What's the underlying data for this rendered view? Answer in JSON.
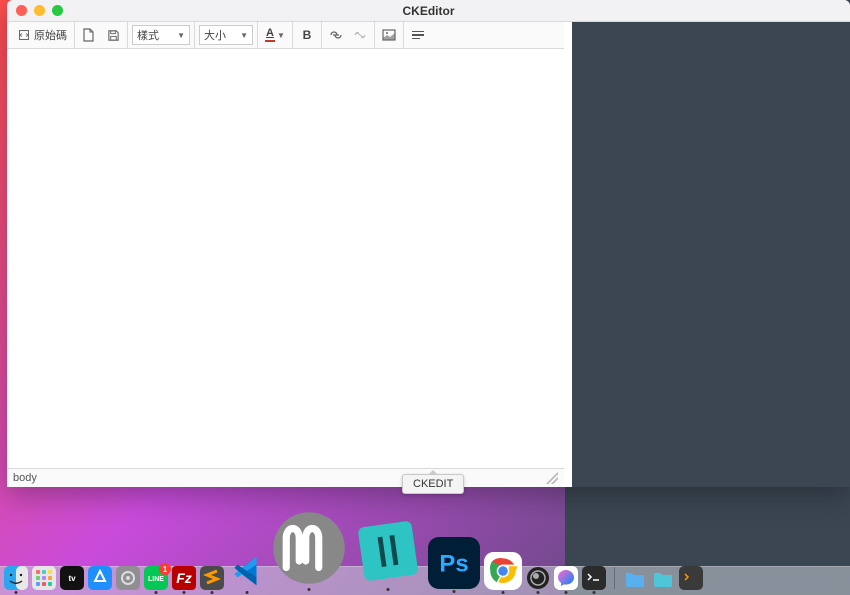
{
  "window": {
    "title": "CKEditor"
  },
  "toolbar": {
    "source_label": "原始碼",
    "styles_label": "樣式",
    "size_label": "大小"
  },
  "status": {
    "path": "body"
  },
  "tooltip": {
    "text": "CKEDIT"
  },
  "dock": {
    "items": [
      "finder",
      "launchpad",
      "appletv",
      "appstore",
      "settings",
      "line",
      "filezilla",
      "sublime",
      "vscode",
      "mamp",
      "ckedit",
      "photoshop",
      "chrome",
      "obs",
      "messenger",
      "terminal"
    ],
    "folders": [
      "folder-blue",
      "folder-teal",
      "folder-orange",
      "terminal-dark"
    ]
  }
}
